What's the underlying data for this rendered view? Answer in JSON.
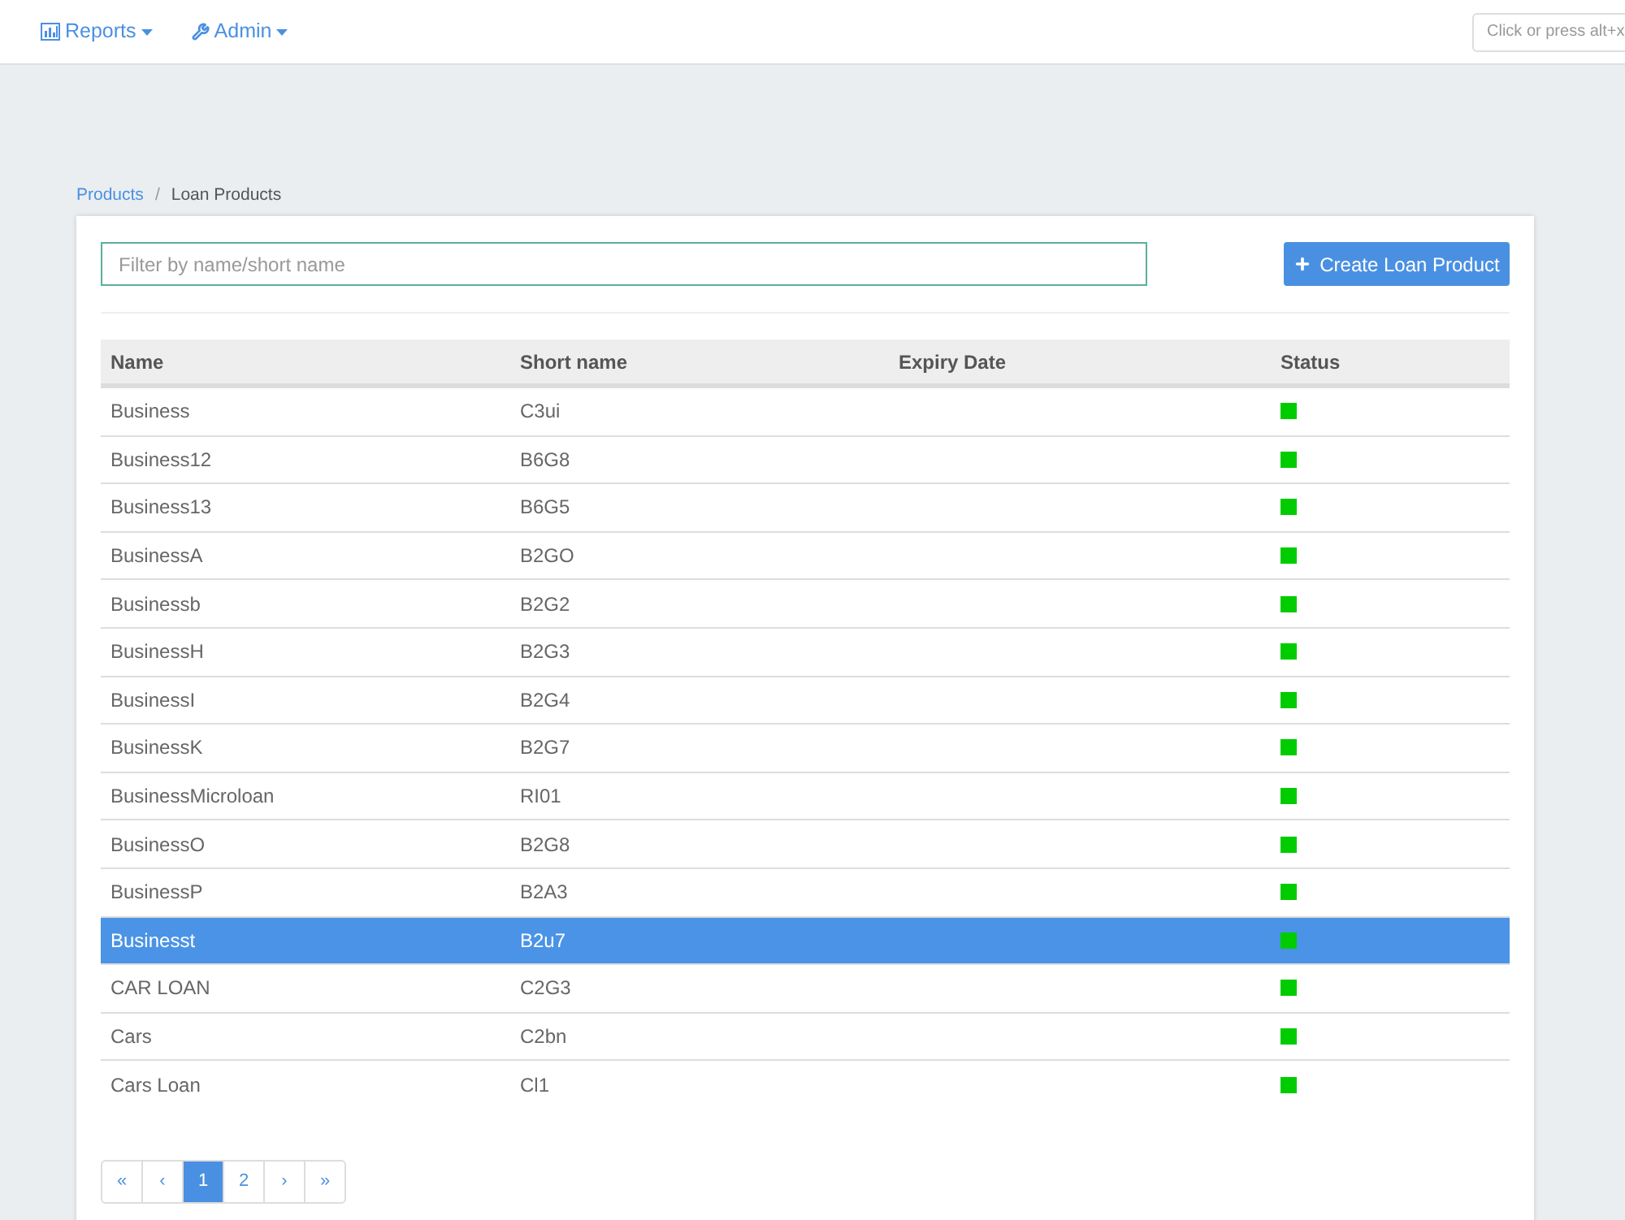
{
  "nav": {
    "items": [
      {
        "label": "Reports",
        "kind": "chart"
      },
      {
        "label": "Admin",
        "kind": "wrench"
      }
    ],
    "search": {
      "placeholder": "Click or press alt+x"
    }
  },
  "breadcrumb": {
    "separator": "/",
    "items": [
      {
        "label": "Products",
        "link": true
      },
      {
        "label": "Loan Products",
        "link": false
      }
    ]
  },
  "filter": {
    "placeholder": "Filter by name/short name",
    "focused": true
  },
  "create_button": {
    "label": "Create Loan Product"
  },
  "table": {
    "columns": [
      "Name",
      "Short name",
      "Expiry Date",
      "Status"
    ],
    "rows": [
      {
        "name": "Business",
        "short_name": "C3ui",
        "active": true,
        "selected": false
      },
      {
        "name": "Business12",
        "short_name": "B6G8",
        "active": true,
        "selected": false
      },
      {
        "name": "Business13",
        "short_name": "B6G5",
        "active": true,
        "selected": false
      },
      {
        "name": "BusinessA",
        "short_name": "B2GO",
        "active": true,
        "selected": false
      },
      {
        "name": "Businessb",
        "short_name": "B2G2",
        "active": true,
        "selected": false
      },
      {
        "name": "BusinessH",
        "short_name": "B2G3",
        "active": true,
        "selected": false
      },
      {
        "name": "BusinessI",
        "short_name": "B2G4",
        "active": true,
        "selected": false
      },
      {
        "name": "BusinessK",
        "short_name": "B2G7",
        "active": true,
        "selected": false
      },
      {
        "name": "BusinessMicroloan",
        "short_name": "RI01",
        "active": true,
        "selected": false
      },
      {
        "name": "BusinessO",
        "short_name": "B2G8",
        "active": true,
        "selected": false
      },
      {
        "name": "BusinessP",
        "short_name": "B2A3",
        "active": true,
        "selected": false
      },
      {
        "name": "Businesst",
        "short_name": "B2u7",
        "active": true,
        "selected": true
      },
      {
        "name": "CAR LOAN",
        "short_name": "C2G3",
        "active": true,
        "selected": false
      },
      {
        "name": "Cars",
        "short_name": "C2bn",
        "active": true,
        "selected": false
      },
      {
        "name": "Cars Loan",
        "short_name": "Cl1",
        "active": true,
        "selected": false
      }
    ]
  },
  "pagination": [
    {
      "label": "«",
      "selected": false
    },
    {
      "label": "‹",
      "selected": false
    },
    {
      "label": "1",
      "selected": true
    },
    {
      "label": "2",
      "selected": false
    },
    {
      "label": "›",
      "selected": false
    },
    {
      "label": "»",
      "selected": false
    }
  ]
}
